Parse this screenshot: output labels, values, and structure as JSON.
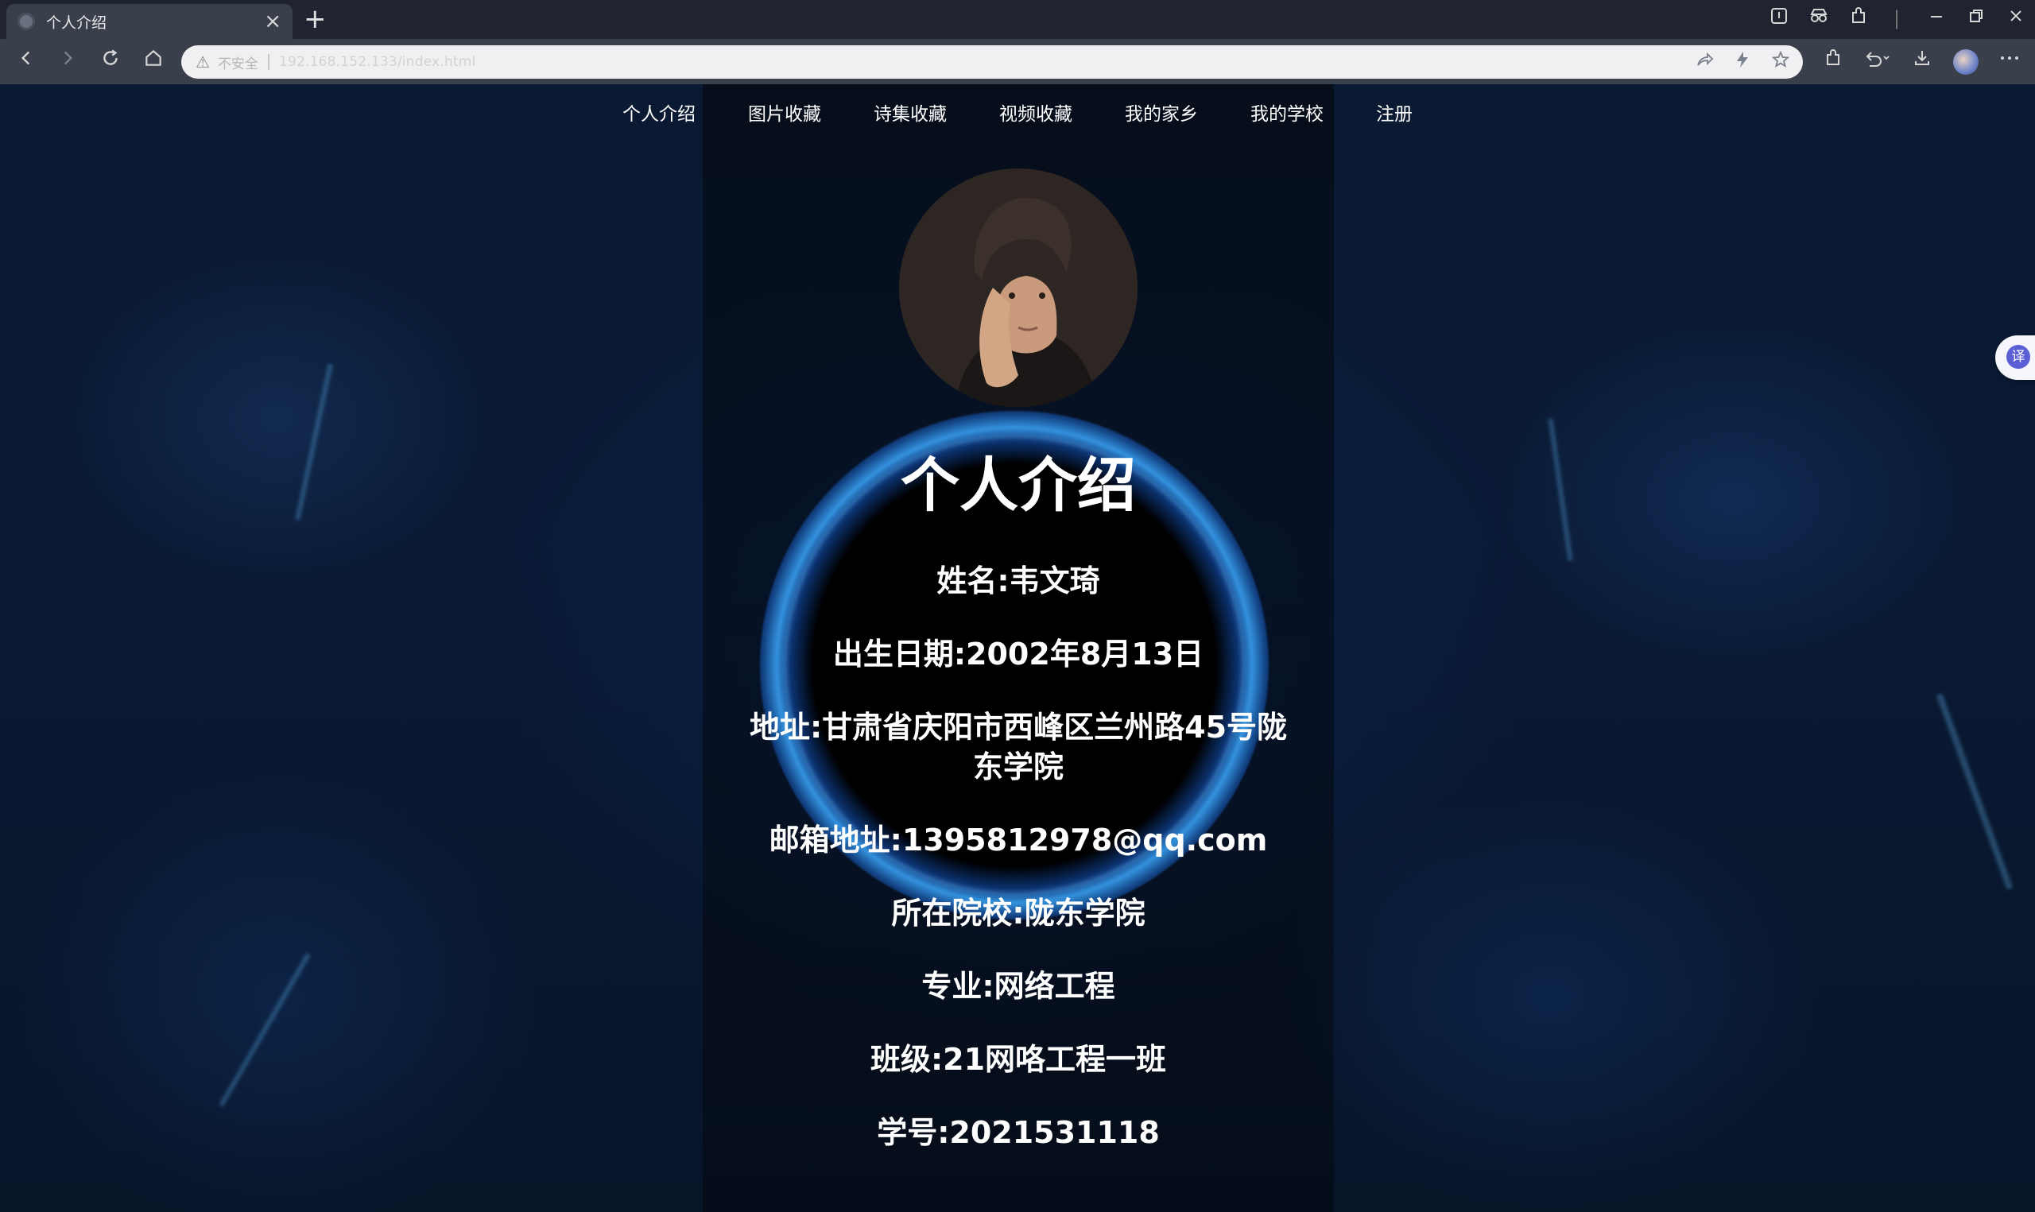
{
  "browser": {
    "tab_title": "个人介绍",
    "tab_close": "×",
    "new_tab": "+",
    "address_insecure_label": "不安全",
    "address_url": "192.168.152.133/index.html"
  },
  "nav": {
    "items": [
      "个人介绍",
      "图片收藏",
      "诗集收藏",
      "视频收藏",
      "我的家乡",
      "我的学校",
      "注册"
    ]
  },
  "intro": {
    "heading": "个人介绍",
    "lines": [
      "姓名:韦文琦",
      "出生日期:2002年8月13日",
      "地址:甘肃省庆阳市西峰区兰州路45号陇东学院",
      "邮箱地址:1395812978@qq.com",
      "所在院校:陇东学院",
      "专业:网络工程",
      "班级:21网咯工程一班",
      "学号:2021531118"
    ]
  },
  "translate_button": "译",
  "colors": {
    "title_bar": "#1f2430",
    "toolbar": "#3a3f4c",
    "address_bar": "#f0f0f2",
    "page_background": "#0a1a35",
    "text": "#ffffff",
    "ring_glow": "#3ca6ff"
  },
  "icons": {
    "toolbar": [
      "back-icon",
      "forward-icon",
      "reload-icon",
      "home-icon",
      "warning-icon",
      "share-icon",
      "lightning-icon",
      "star-icon",
      "extensions-icon",
      "undo-icon",
      "download-icon",
      "more-icon"
    ],
    "window": [
      "reading-mode-icon",
      "incognito-icon",
      "extension-icon",
      "minimize-icon",
      "restore-icon",
      "close-icon"
    ]
  }
}
